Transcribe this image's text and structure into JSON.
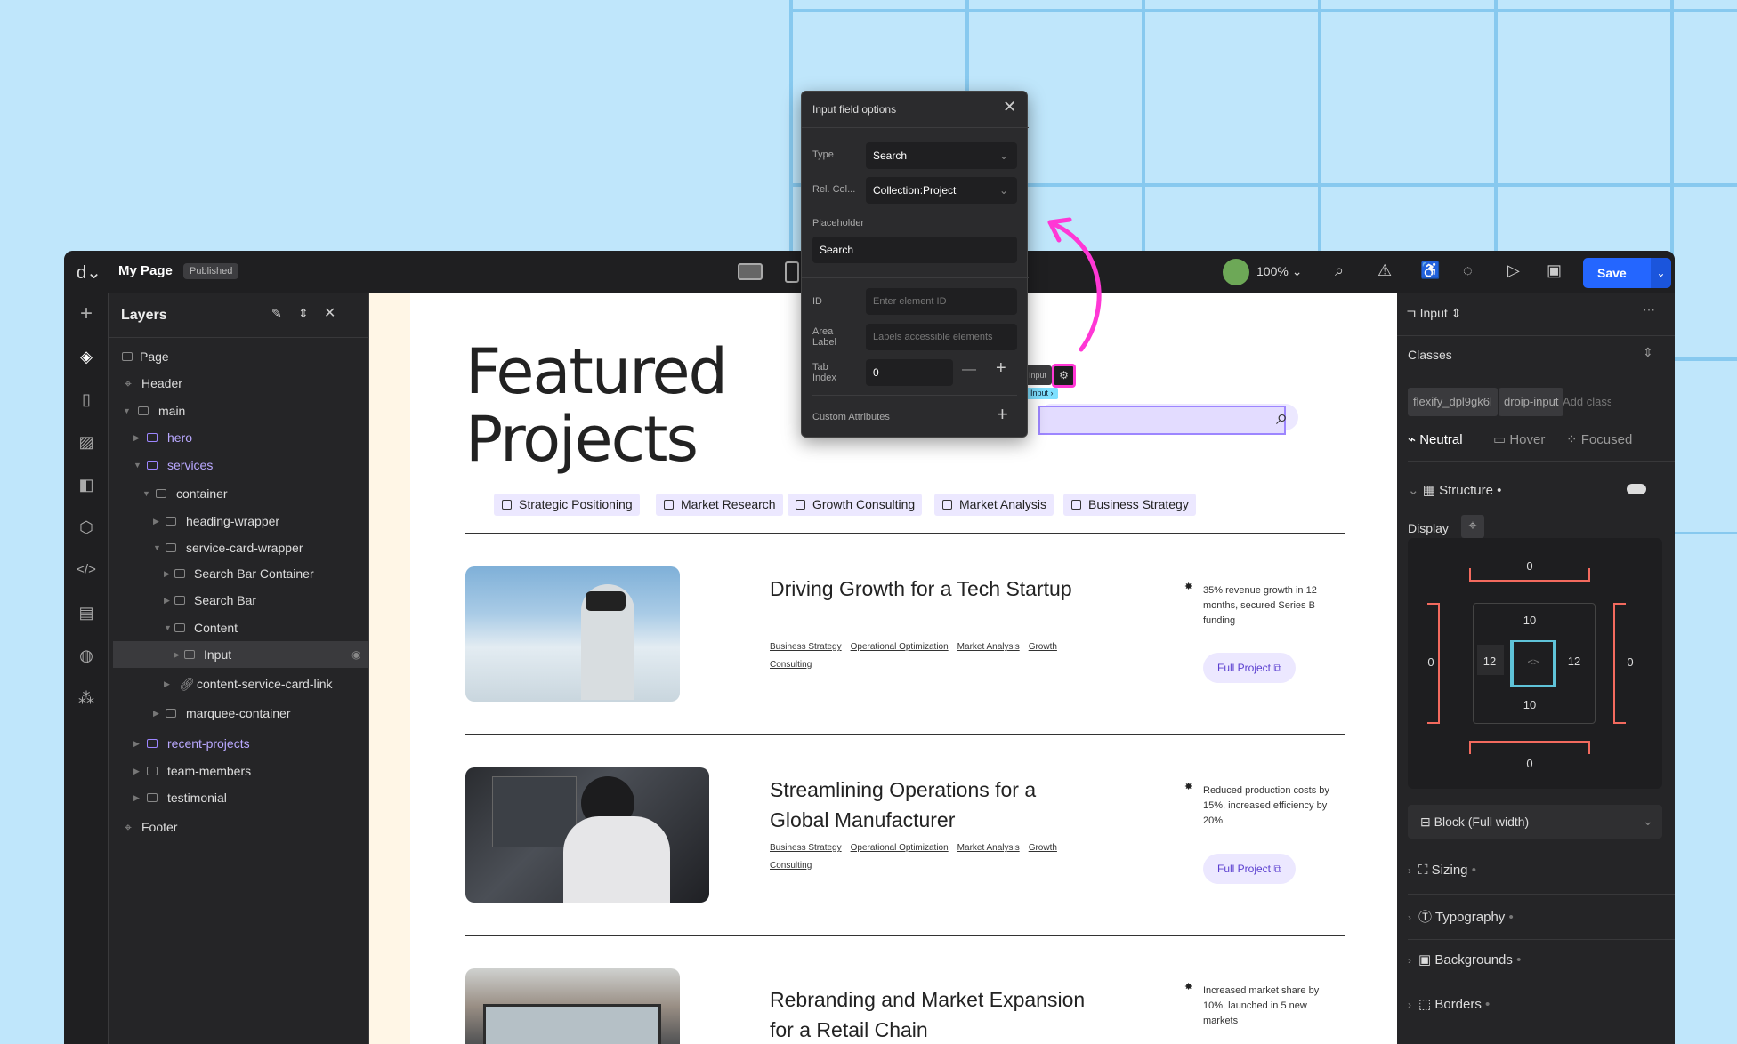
{
  "colors": {
    "accent": "#2466ff",
    "magenta": "#ff37d5",
    "selection": "#9d86ff",
    "chip_bg": "#ece8ff"
  },
  "topbar": {
    "title": "My Page",
    "status": "Published",
    "zoom": "100%",
    "save": "Save"
  },
  "layers": {
    "title": "Layers",
    "items": [
      {
        "label": "Page"
      },
      {
        "label": "Header"
      },
      {
        "label": "main"
      },
      {
        "label": "hero"
      },
      {
        "label": "services"
      },
      {
        "label": "container"
      },
      {
        "label": "heading-wrapper"
      },
      {
        "label": "service-card-wrapper"
      },
      {
        "label": "Search Bar Container"
      },
      {
        "label": "Search Bar"
      },
      {
        "label": "Content"
      },
      {
        "label": "Input"
      },
      {
        "label": "content-service-card-link"
      },
      {
        "label": "marquee-container"
      },
      {
        "label": "recent-projects"
      },
      {
        "label": "team-members"
      },
      {
        "label": "testimonial"
      },
      {
        "label": "Footer"
      }
    ]
  },
  "canvas": {
    "heading_line1": "Featured",
    "heading_line2": "Projects",
    "chips": [
      "Strategic Positioning",
      "Market Research",
      "Growth Consulting",
      "Market Analysis",
      "Business Strategy"
    ],
    "input_badge": "Input",
    "input_tag": "Input",
    "cards": [
      {
        "title": "Driving Growth for a Tech Startup",
        "tags": [
          "Business Strategy",
          "Operational Optimization",
          "Market Analysis",
          "Growth Consulting"
        ],
        "desc": "35% revenue growth in 12 months, secured Series B funding",
        "button": "Full Project"
      },
      {
        "title": "Streamlining Operations for a Global Manufacturer",
        "tags": [
          "Business Strategy",
          "Operational Optimization",
          "Market Analysis",
          "Growth Consulting"
        ],
        "desc": "Reduced production costs by 15%, increased efficiency by 20%",
        "button": "Full Project"
      },
      {
        "title": "Rebranding and Market Expansion for a Retail Chain",
        "desc": "Increased market share by 10%, launched in 5 new markets"
      }
    ]
  },
  "modal": {
    "title": "Input field options",
    "type_label": "Type",
    "type_value": "Search",
    "rel_label": "Rel. Col...",
    "rel_value": "Collection:Project",
    "placeholder_label": "Placeholder",
    "placeholder_value": "Search",
    "id_label": "ID",
    "id_placeholder": "Enter element ID",
    "area_label": "Area Label",
    "area_placeholder": "Labels accessible elements",
    "tab_label": "Tab Index",
    "tab_value": "0",
    "custom_label": "Custom Attributes"
  },
  "right": {
    "element": "Input",
    "classes_label": "Classes",
    "classes": [
      "flexify_dpl9gk6l",
      "droip-input"
    ],
    "add_class": "Add class",
    "states": [
      "Neutral",
      "Hover",
      "Focused"
    ],
    "structure": "Structure",
    "display": "Display",
    "margin": {
      "top": "0",
      "right": "0",
      "bottom": "0",
      "left": "0"
    },
    "padding": {
      "top": "10",
      "right": "12",
      "bottom": "10",
      "left": "12"
    },
    "block": "Block (Full width)",
    "sections": [
      "Sizing",
      "Typography",
      "Backgrounds",
      "Borders"
    ]
  }
}
